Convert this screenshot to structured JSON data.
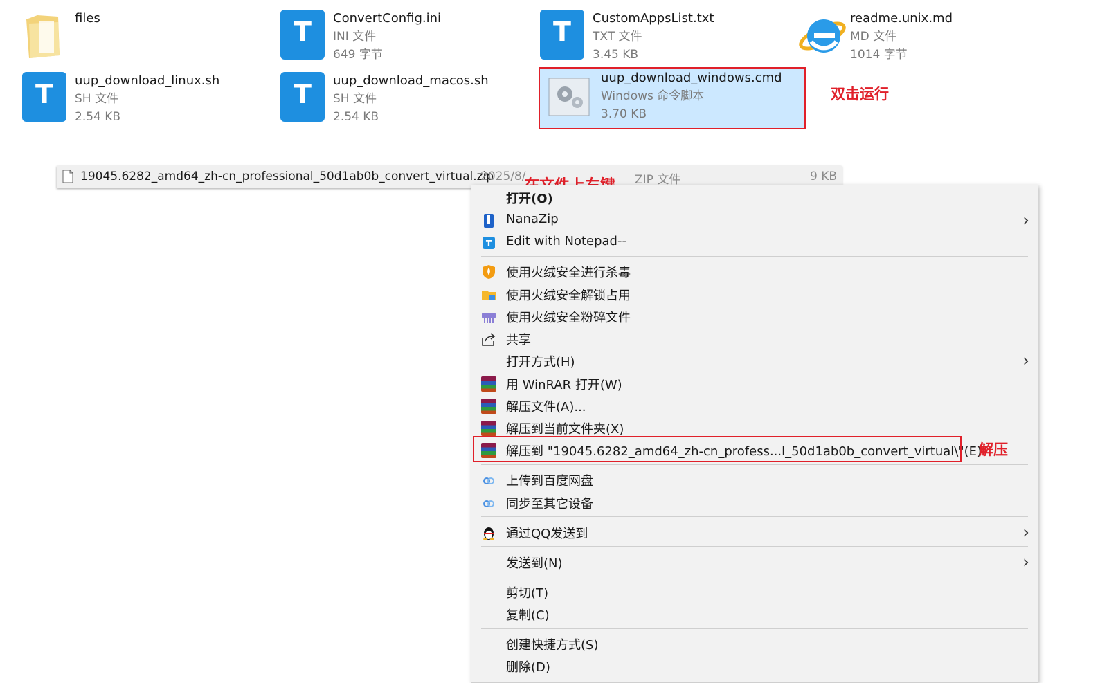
{
  "files": [
    {
      "name": "files",
      "meta1": "",
      "meta2": "",
      "icon": "folder-icon"
    },
    {
      "name": "ConvertConfig.ini",
      "meta1": "INI 文件",
      "meta2": "649 字节",
      "icon": "notepad-t-icon"
    },
    {
      "name": "CustomAppsList.txt",
      "meta1": "TXT 文件",
      "meta2": "3.45 KB",
      "icon": "notepad-t-icon"
    },
    {
      "name": "readme.unix.md",
      "meta1": "MD 文件",
      "meta2": "1014 字节",
      "icon": "ie-icon"
    },
    {
      "name": "uup_download_linux.sh",
      "meta1": "SH 文件",
      "meta2": "2.54 KB",
      "icon": "notepad-t-icon"
    },
    {
      "name": "uup_download_macos.sh",
      "meta1": "SH 文件",
      "meta2": "2.54 KB",
      "icon": "notepad-t-icon"
    },
    {
      "name": "uup_download_windows.cmd",
      "meta1": "Windows 命令脚本",
      "meta2": "3.70 KB",
      "icon": "gear-script-icon"
    }
  ],
  "annotations": {
    "double_click": "双击运行",
    "right_click": "在文件上右键",
    "extract": "解压"
  },
  "zip_row": {
    "name": "19045.6282_amd64_zh-cn_professional_50d1ab0b_convert_virtual.zip",
    "date": "2025/8/",
    "type": "ZIP 文件",
    "size": "9 KB"
  },
  "menu": {
    "open": "打开(O)",
    "nanazip": "NanaZip",
    "notepad": "Edit with Notepad--",
    "huorong_scan": "使用火绒安全进行杀毒",
    "huorong_unlock": "使用火绒安全解锁占用",
    "huorong_shred": "使用火绒安全粉碎文件",
    "share": "共享",
    "open_with": "打开方式(H)",
    "winrar_open": "用 WinRAR 打开(W)",
    "extract_files": "解压文件(A)...",
    "extract_here": "解压到当前文件夹(X)",
    "extract_to": "解压到 \"19045.6282_amd64_zh-cn_profess...l_50d1ab0b_convert_virtual\\\"(E)",
    "baidu_upload": "上传到百度网盘",
    "sync_devices": "同步至其它设备",
    "qq_send": "通过QQ发送到",
    "send_to": "发送到(N)",
    "cut": "剪切(T)",
    "copy": "复制(C)",
    "shortcut": "创建快捷方式(S)",
    "delete": "删除(D)"
  },
  "colors": {
    "accent": "#1e8fe0",
    "annotation": "#e0202a",
    "selection": "#cce8ff"
  }
}
